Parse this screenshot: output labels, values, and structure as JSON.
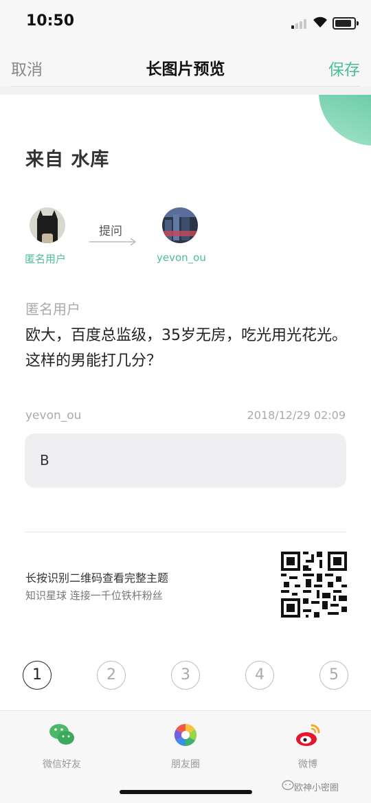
{
  "status_bar": {
    "time": "10:50"
  },
  "nav": {
    "cancel": "取消",
    "title": "长图片预览",
    "save": "保存"
  },
  "card": {
    "from": "来自 水库",
    "asker_avatar_name": "匿名用户",
    "ask_label": "提问",
    "answerer_avatar_name": "yevon_ou",
    "asker": "匿名用户",
    "question": "欧大，百度总监级，35岁无房，吃光用光花光。这样的男能打几分？",
    "answerer": "yevon_ou",
    "timestamp": "2018/12/29 02:09",
    "answer": "B",
    "qr_line1": "长按识别二维码查看完整主题",
    "qr_line2": "知识星球  连接一千位铁杆粉丝"
  },
  "pages": [
    "1",
    "2",
    "3",
    "4",
    "5"
  ],
  "share": {
    "wechat": "微信好友",
    "moments": "朋友圈",
    "weibo": "微博"
  },
  "watermark": "欧神小密圈",
  "colors": {
    "accent": "#4cbf96"
  }
}
